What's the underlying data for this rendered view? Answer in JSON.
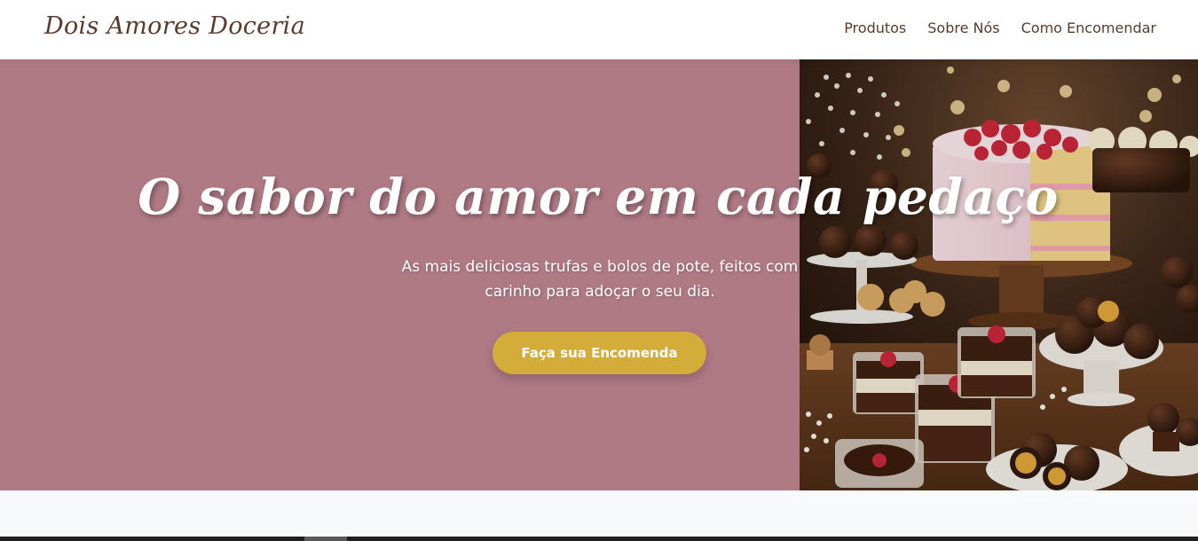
{
  "header": {
    "brand": "Dois Amores Doceria",
    "nav": [
      {
        "label": "Produtos"
      },
      {
        "label": "Sobre Nós"
      },
      {
        "label": "Como Encomendar"
      }
    ]
  },
  "hero": {
    "title": "O sabor do amor em cada pedaço",
    "subtitle": "As mais deliciosas trufas e bolos de pote, feitos com carinho para adoçar o seu dia.",
    "cta_label": "Faça sua Encomenda",
    "photo_alt": "Bolo com morangos, trufas e bolos de pote"
  },
  "colors": {
    "hero_bg": "#b07a85",
    "brand_text": "#5b3a2e",
    "cta_bg": "#d4ac3a"
  }
}
